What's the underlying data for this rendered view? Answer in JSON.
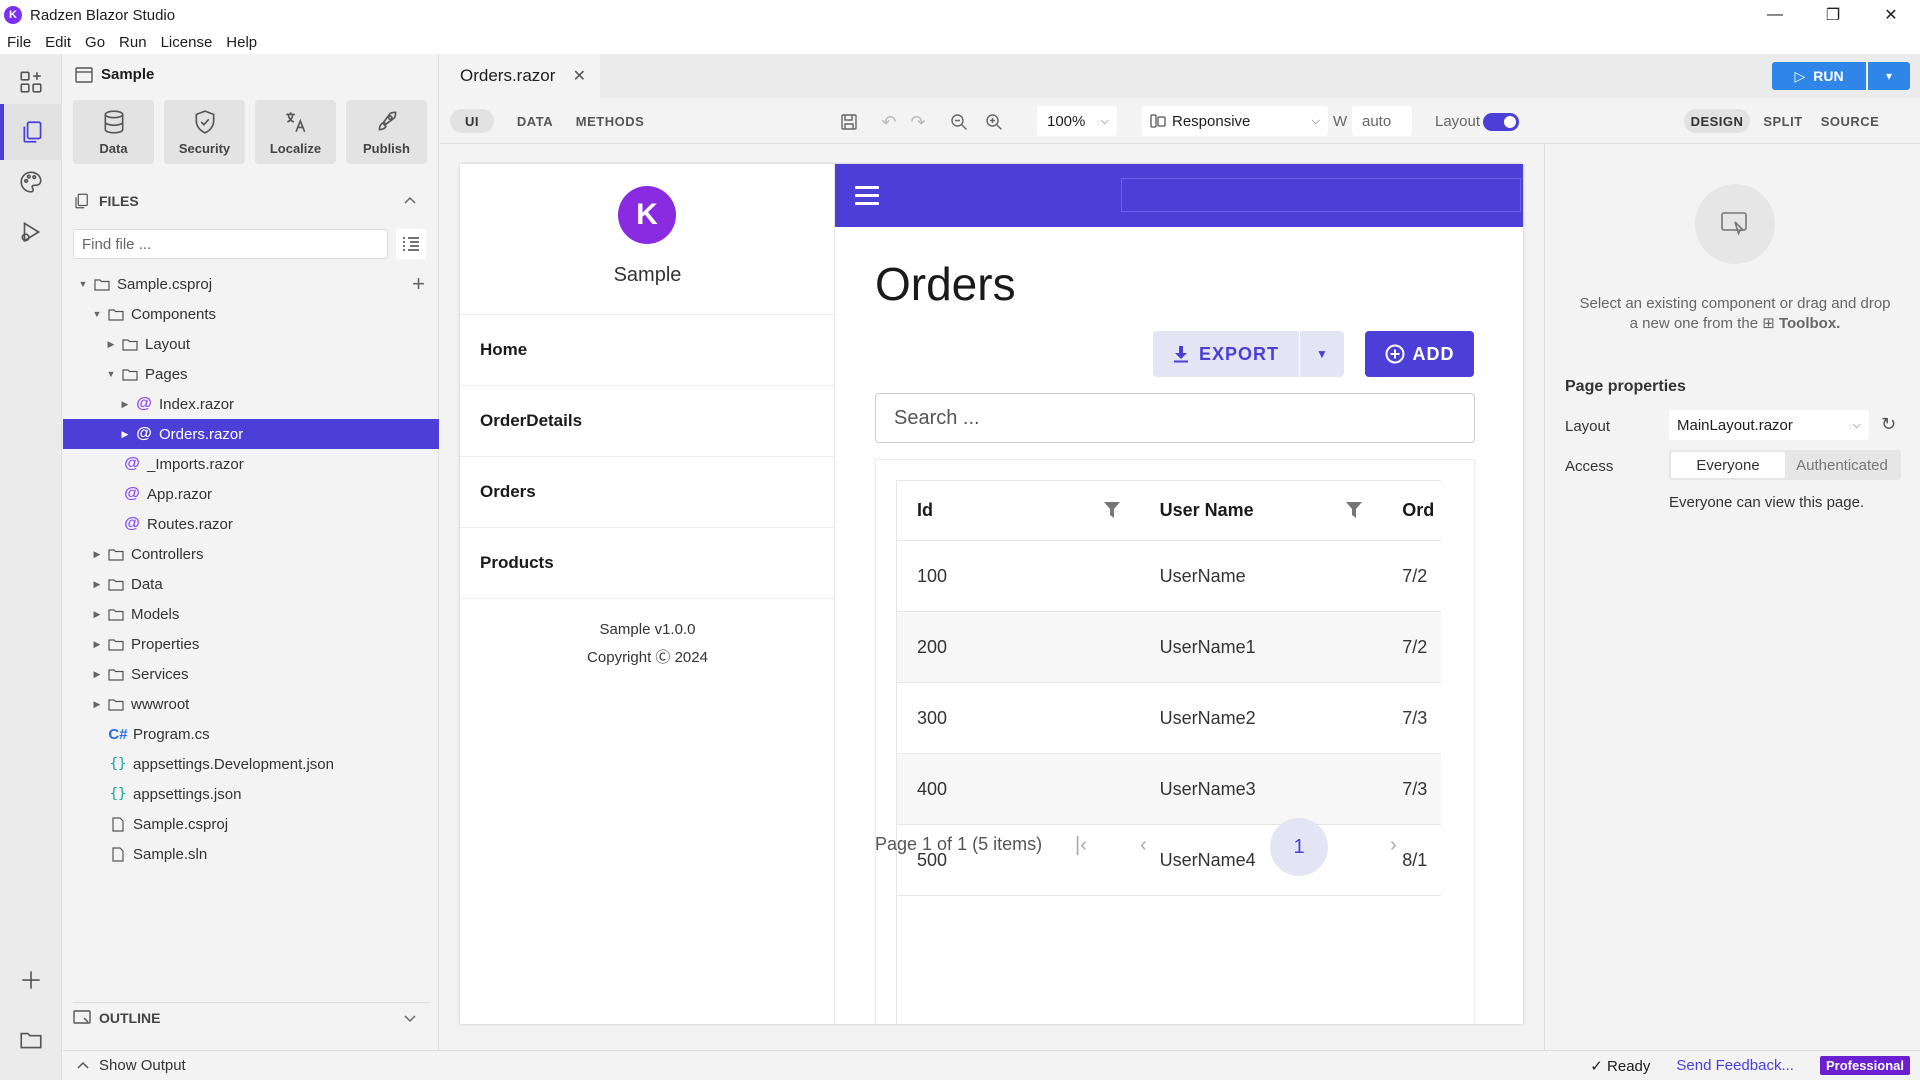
{
  "window": {
    "title": "Radzen Blazor Studio",
    "controls": [
      "—",
      "❐",
      "✕"
    ]
  },
  "menu": [
    "File",
    "Edit",
    "Go",
    "Run",
    "License",
    "Help"
  ],
  "sidebar": {
    "project": "Sample",
    "tools": [
      {
        "label": "Data",
        "icon": "database-icon"
      },
      {
        "label": "Security",
        "icon": "shield-icon"
      },
      {
        "label": "Localize",
        "icon": "translate-icon"
      },
      {
        "label": "Publish",
        "icon": "rocket-icon"
      }
    ],
    "files_title": "FILES",
    "find_placeholder": "Find file ...",
    "tree": [
      {
        "label": "Sample.csproj",
        "type": "folder",
        "depth": 0,
        "expanded": true
      },
      {
        "label": "Components",
        "type": "folder",
        "depth": 1,
        "expanded": true
      },
      {
        "label": "Layout",
        "type": "folder",
        "depth": 2,
        "expanded": false
      },
      {
        "label": "Pages",
        "type": "folder",
        "depth": 2,
        "expanded": true
      },
      {
        "label": "Index.razor",
        "type": "razor",
        "depth": 3,
        "expanded": false
      },
      {
        "label": "Orders.razor",
        "type": "razor",
        "depth": 3,
        "expanded": false,
        "selected": true
      },
      {
        "label": "_Imports.razor",
        "type": "razor",
        "depth": 2
      },
      {
        "label": "App.razor",
        "type": "razor",
        "depth": 2
      },
      {
        "label": "Routes.razor",
        "type": "razor",
        "depth": 2
      },
      {
        "label": "Controllers",
        "type": "folder",
        "depth": 1,
        "expanded": false
      },
      {
        "label": "Data",
        "type": "folder",
        "depth": 1,
        "expanded": false
      },
      {
        "label": "Models",
        "type": "folder",
        "depth": 1,
        "expanded": false
      },
      {
        "label": "Properties",
        "type": "folder",
        "depth": 1,
        "expanded": false
      },
      {
        "label": "Services",
        "type": "folder",
        "depth": 1,
        "expanded": false
      },
      {
        "label": "wwwroot",
        "type": "folder",
        "depth": 1,
        "expanded": false
      },
      {
        "label": "Program.cs",
        "type": "cs",
        "depth": 1
      },
      {
        "label": "appsettings.Development.json",
        "type": "json",
        "depth": 1
      },
      {
        "label": "appsettings.json",
        "type": "json",
        "depth": 1
      },
      {
        "label": "Sample.csproj",
        "type": "file",
        "depth": 1
      },
      {
        "label": "Sample.sln",
        "type": "file",
        "depth": 1
      }
    ],
    "outline_title": "OUTLINE"
  },
  "status": {
    "show_output": "Show Output",
    "ready": "Ready",
    "feedback": "Send Feedback...",
    "edition": "Professional"
  },
  "editor": {
    "tab": "Orders.razor",
    "run_label": "RUN",
    "modes": [
      "UI",
      "DATA",
      "METHODS"
    ],
    "zoom": "100%",
    "responsive": "Responsive",
    "width_label": "W",
    "width_value": "auto",
    "layout_label": "Layout",
    "views": [
      "DESIGN",
      "SPLIT",
      "SOURCE"
    ]
  },
  "preview": {
    "logo_letter": "K",
    "app_name": "Sample",
    "nav": [
      "Home",
      "OrderDetails",
      "Orders",
      "Products"
    ],
    "version": "Sample v1.0.0",
    "copyright": "Copyright Ⓒ 2024",
    "page_title": "Orders",
    "export_label": "EXPORT",
    "add_label": "ADD",
    "search_placeholder": "Search ...",
    "columns": [
      "Id",
      "User Name",
      "Ord"
    ],
    "rows": [
      [
        "100",
        "UserName",
        "7/2"
      ],
      [
        "200",
        "UserName1",
        "7/2"
      ],
      [
        "300",
        "UserName2",
        "7/3"
      ],
      [
        "400",
        "UserName3",
        "7/3"
      ],
      [
        "500",
        "UserName4",
        "8/1"
      ]
    ],
    "pager_text": "Page 1 of 1 (5 items)",
    "current_page": "1"
  },
  "props": {
    "empty_hint_1": "Select an existing component or drag and drop",
    "empty_hint_2": "a new one from the",
    "empty_hint_3": "Toolbox.",
    "section_title": "Page properties",
    "layout_label": "Layout",
    "layout_value": "MainLayout.razor",
    "access_label": "Access",
    "access_options": [
      "Everyone",
      "Authenticated"
    ],
    "access_hint": "Everyone can view this page."
  },
  "colors": {
    "accent": "#4b3fd8",
    "run": "#2f86e8",
    "brand": "#7b2ff7"
  }
}
